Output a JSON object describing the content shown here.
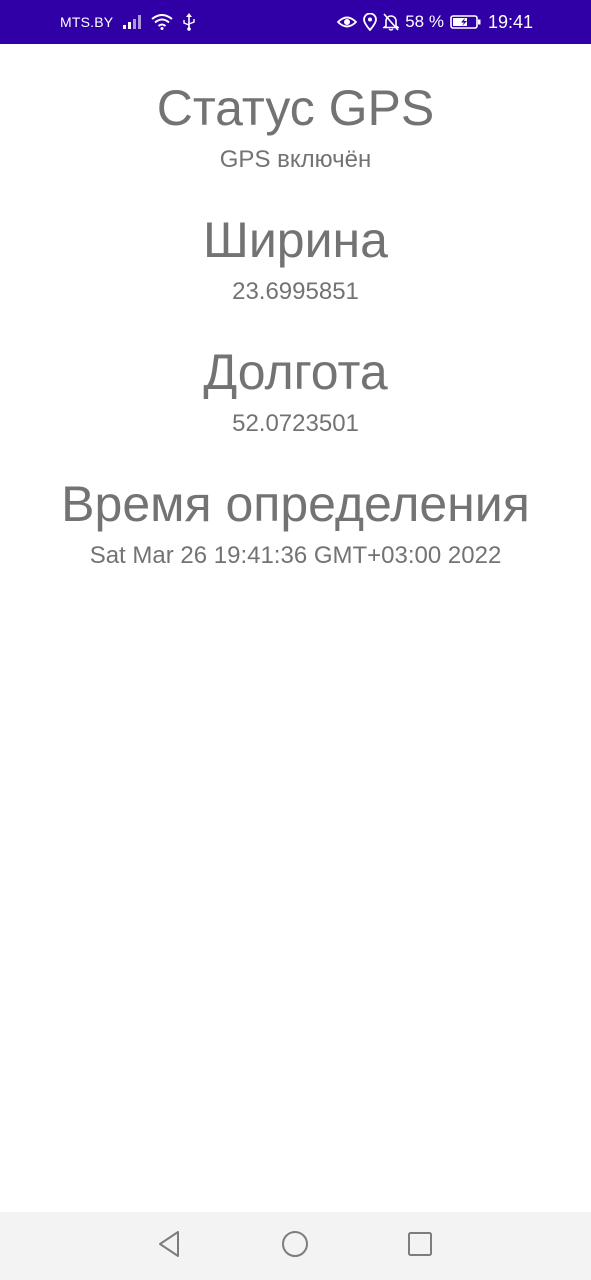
{
  "status_bar": {
    "carrier": "MTS.BY",
    "battery_percent": "58 %",
    "time": "19:41",
    "icons": [
      "signal-icon",
      "wifi-icon",
      "usb-icon",
      "eye-comfort-icon",
      "location-icon",
      "notifications-muted-icon",
      "battery-charging-icon"
    ],
    "background": "#3000A6"
  },
  "gps": {
    "status_title": "Статус GPS",
    "status_value": "GPS включён",
    "latitude_title": "Ширина",
    "latitude_value": "23.6995851",
    "longitude_title": "Долгота",
    "longitude_value": "52.0723501",
    "time_title": "Время определения",
    "time_value": "Sat Mar 26 19:41:36 GMT+03:00 2022"
  },
  "nav_bar": {
    "icons": [
      "back-icon",
      "home-icon",
      "recents-icon"
    ]
  }
}
